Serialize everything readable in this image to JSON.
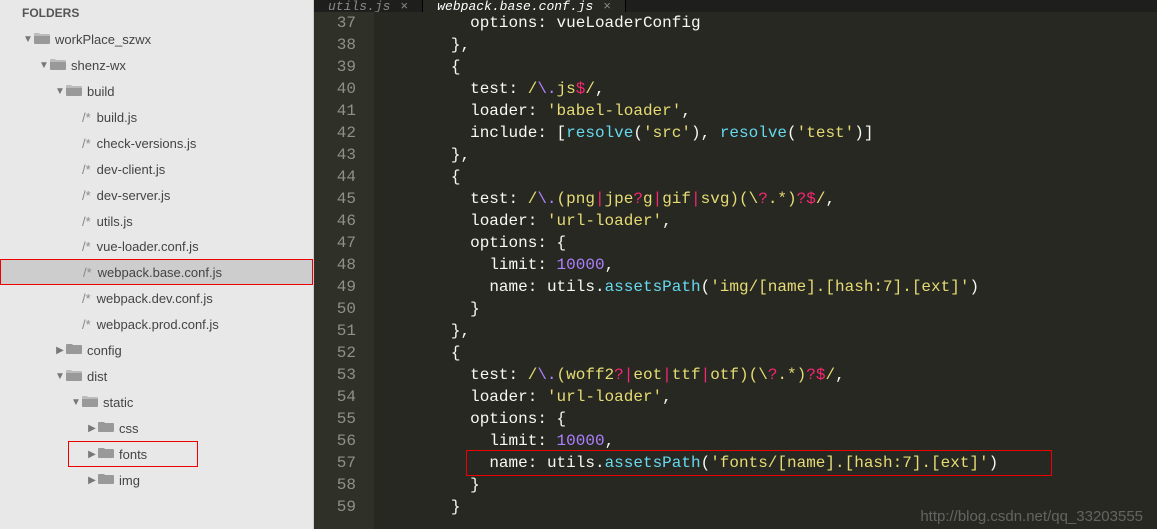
{
  "foldersTitle": "FOLDERS",
  "tree": [
    {
      "indent": 1,
      "arrow": "▼",
      "icon": "folder",
      "label": "workPlace_szwx"
    },
    {
      "indent": 2,
      "arrow": "▼",
      "icon": "folder",
      "label": "shenz-wx"
    },
    {
      "indent": 3,
      "arrow": "▼",
      "icon": "folder",
      "label": "build"
    },
    {
      "indent": 4,
      "arrow": "",
      "icon": "file",
      "label": "build.js"
    },
    {
      "indent": 4,
      "arrow": "",
      "icon": "file",
      "label": "check-versions.js"
    },
    {
      "indent": 4,
      "arrow": "",
      "icon": "file",
      "label": "dev-client.js"
    },
    {
      "indent": 4,
      "arrow": "",
      "icon": "file",
      "label": "dev-server.js"
    },
    {
      "indent": 4,
      "arrow": "",
      "icon": "file",
      "label": "utils.js"
    },
    {
      "indent": 4,
      "arrow": "",
      "icon": "file",
      "label": "vue-loader.conf.js",
      "boxTop": true
    },
    {
      "indent": 4,
      "arrow": "",
      "icon": "file",
      "label": "webpack.base.conf.js",
      "selected": true,
      "box": true
    },
    {
      "indent": 4,
      "arrow": "",
      "icon": "file",
      "label": "webpack.dev.conf.js"
    },
    {
      "indent": 4,
      "arrow": "",
      "icon": "file",
      "label": "webpack.prod.conf.js"
    },
    {
      "indent": 3,
      "arrow": "▶",
      "icon": "folder-closed",
      "label": "config"
    },
    {
      "indent": 3,
      "arrow": "▼",
      "icon": "folder",
      "label": "dist"
    },
    {
      "indent": 4,
      "arrow": "▼",
      "icon": "folder",
      "label": "static"
    },
    {
      "indent": 5,
      "arrow": "▶",
      "icon": "folder-closed",
      "label": "css"
    },
    {
      "indent": 5,
      "arrow": "▶",
      "icon": "folder-closed",
      "label": "fonts",
      "box2": true
    },
    {
      "indent": 5,
      "arrow": "▶",
      "icon": "folder-closed",
      "label": "img"
    }
  ],
  "tabs": [
    {
      "label": "utils.js",
      "active": false
    },
    {
      "label": "webpack.base.conf.js",
      "active": true
    }
  ],
  "closeGlyph": "×",
  "lineStart": 37,
  "lineEnd": 59,
  "code": [
    "          options: vueLoaderConfig",
    "        },",
    "        {",
    "          test: /\\.js$/,",
    "          loader: 'babel-loader',",
    "          include: [resolve('src'), resolve('test')]",
    "        },",
    "        {",
    "          test: /\\.(png|jpe?g|gif|svg)(\\?.*)?$/,",
    "          loader: 'url-loader',",
    "          options: {",
    "            limit: 10000,",
    "            name: utils.assetsPath('img/[name].[hash:7].[ext]')",
    "          }",
    "        },",
    "        {",
    "          test: /\\.(woff2?|eot|ttf|otf)(\\?.*)?$/,",
    "          loader: 'url-loader',",
    "          options: {",
    "            limit: 10000,",
    "            name: utils.assetsPath('fonts/[name].[hash:7].[ext]')",
    "          }",
    "        }"
  ],
  "watermark": "http://blog.csdn.net/qq_33203555"
}
